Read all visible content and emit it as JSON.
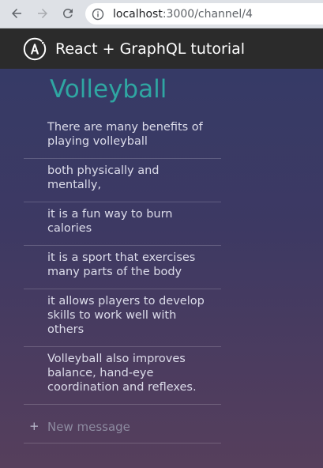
{
  "browser": {
    "url_host": "localhost",
    "url_rest": ":3000/channel/4"
  },
  "app": {
    "title": "React + GraphQL tutorial"
  },
  "channel": {
    "name": "Volleyball",
    "messages": [
      "There are many benefits of playing volleyball",
      "both physically and mentally,",
      "it is a fun way to burn calories",
      "it is a sport that exercises many parts of the body",
      "it allows players to develop skills to work well with others",
      "Volleyball also improves balance, hand-eye coordination and reflexes."
    ]
  },
  "composer": {
    "icon": "plus-icon",
    "placeholder": "New message"
  },
  "colors": {
    "header_bg": "#2b2b2b",
    "channel_title": "#2fa6a2"
  }
}
